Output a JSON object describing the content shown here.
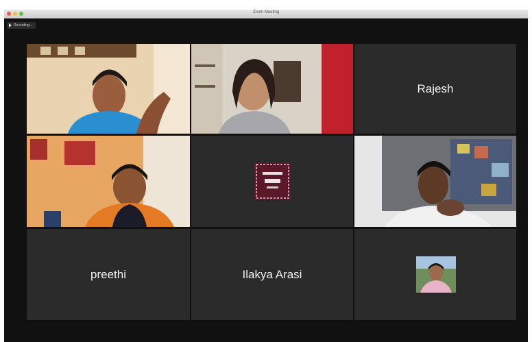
{
  "window": {
    "title": "Zoom Meeting"
  },
  "recording": {
    "label": "Recording..."
  },
  "participants": [
    {
      "id": "p1",
      "type": "video",
      "active_speaker": true
    },
    {
      "id": "p2",
      "type": "video"
    },
    {
      "id": "p3",
      "type": "name",
      "name": "Rajesh"
    },
    {
      "id": "p4",
      "type": "video"
    },
    {
      "id": "p5",
      "type": "avatar"
    },
    {
      "id": "p6",
      "type": "video"
    },
    {
      "id": "p7",
      "type": "name",
      "name": "preethi"
    },
    {
      "id": "p8",
      "type": "name",
      "name": "Ilakya Arasi"
    },
    {
      "id": "p9",
      "type": "avatar"
    }
  ],
  "colors": {
    "tile_bg": "#2a2a2a",
    "window_bg": "#111111",
    "active_border": "#2fbf3a",
    "name_text": "#f2f2f2"
  },
  "icons": {
    "recording": "play-record-icon",
    "window_controls": [
      "close-dot-icon",
      "minimize-dot-icon",
      "zoom-dot-icon"
    ]
  }
}
